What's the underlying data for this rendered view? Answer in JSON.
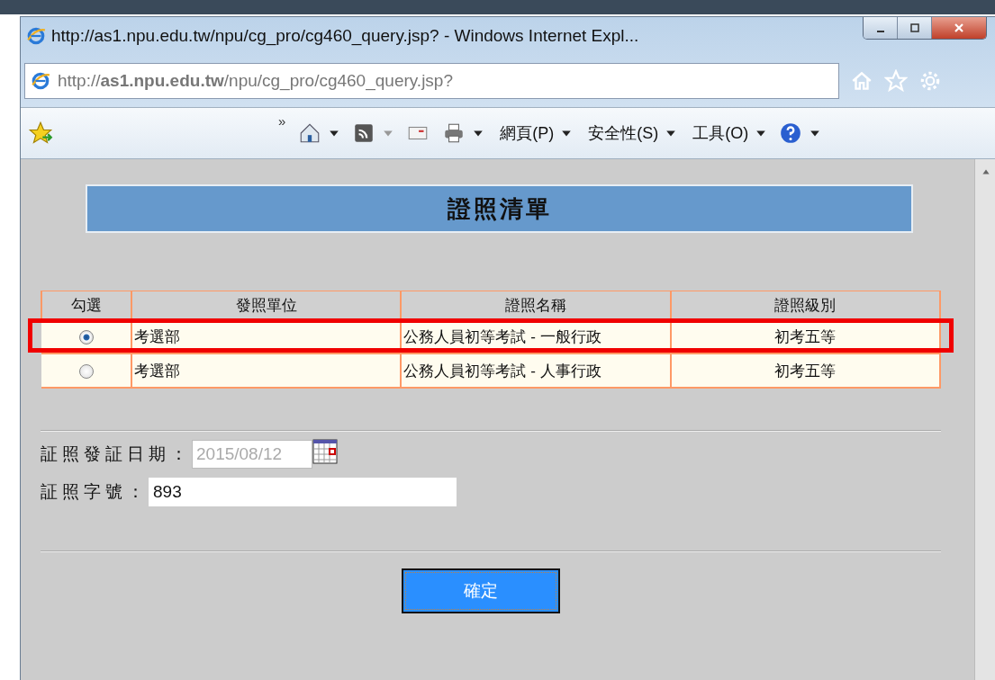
{
  "window": {
    "title": "http://as1.npu.edu.tw/npu/cg_pro/cg460_query.jsp? - Windows Internet Expl..."
  },
  "address_bar": {
    "url": "http://**as1.npu.edu.tw**/npu/cg_pro/cg460_query.jsp?"
  },
  "command_bar": {
    "chevron": "»",
    "menus": [
      "網頁(P)",
      "安全性(S)",
      "工具(O)"
    ]
  },
  "page": {
    "heading": "證照清單",
    "table": {
      "columns": [
        "勾選",
        "發照單位",
        "證照名稱",
        "證照級別"
      ],
      "rows": [
        {
          "selected": true,
          "highlighted": true,
          "cells": [
            "",
            "考選部",
            "公務人員初等考試 - 一般行政",
            "初考五等"
          ]
        },
        {
          "selected": false,
          "highlighted": false,
          "cells": [
            "",
            "考選部",
            "公務人員初等考試 - 人事行政",
            "初考五等"
          ]
        }
      ]
    },
    "fields": [
      {
        "label": "証照發証日期：",
        "value": "2015/08/12",
        "disabled": true,
        "calendar": true
      },
      {
        "label": "証照字號：",
        "value": "893",
        "disabled": false,
        "calendar": false
      }
    ],
    "submit": "確定"
  }
}
